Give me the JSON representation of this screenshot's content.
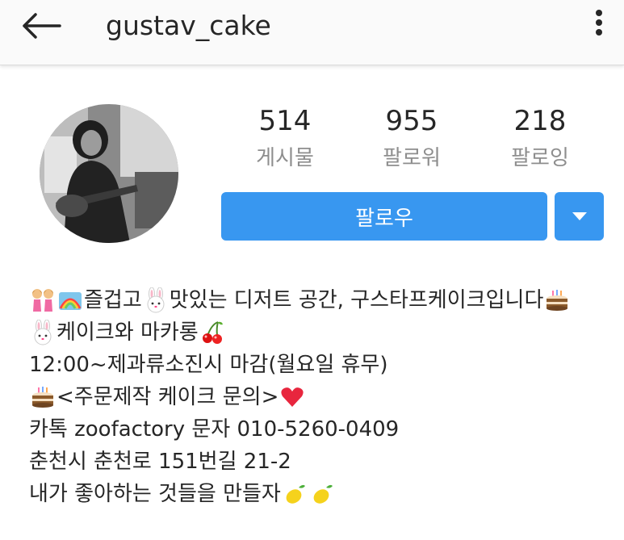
{
  "header": {
    "username": "gustav_cake",
    "back_icon": "arrow-left-icon",
    "more_icon": "more-vertical-icon"
  },
  "profile": {
    "avatar_description": "black-and-white profile photo",
    "stats": [
      {
        "value": "514",
        "label": "게시물"
      },
      {
        "value": "955",
        "label": "팔로워"
      },
      {
        "value": "218",
        "label": "팔로잉"
      }
    ],
    "follow_label": "팔로우",
    "dropdown_icon": "triangle-down-icon",
    "accent_color": "#3897f0"
  },
  "bio": {
    "line1": {
      "a": "즐겁고",
      "b": "맛있는 디저트 공간, 구스타프케이크입니다"
    },
    "line2": "케이크와 마카롱",
    "line3": "12:00~제과류소진시 마감(월요일 휴무)",
    "line4": "<주문제작 케이크 문의>",
    "line5": "카톡 zoofactory 문자 010-5260-0409",
    "line6": "춘천시 춘천로 151번길 21-2",
    "line7": "내가 좋아하는 것들을 만들자"
  }
}
